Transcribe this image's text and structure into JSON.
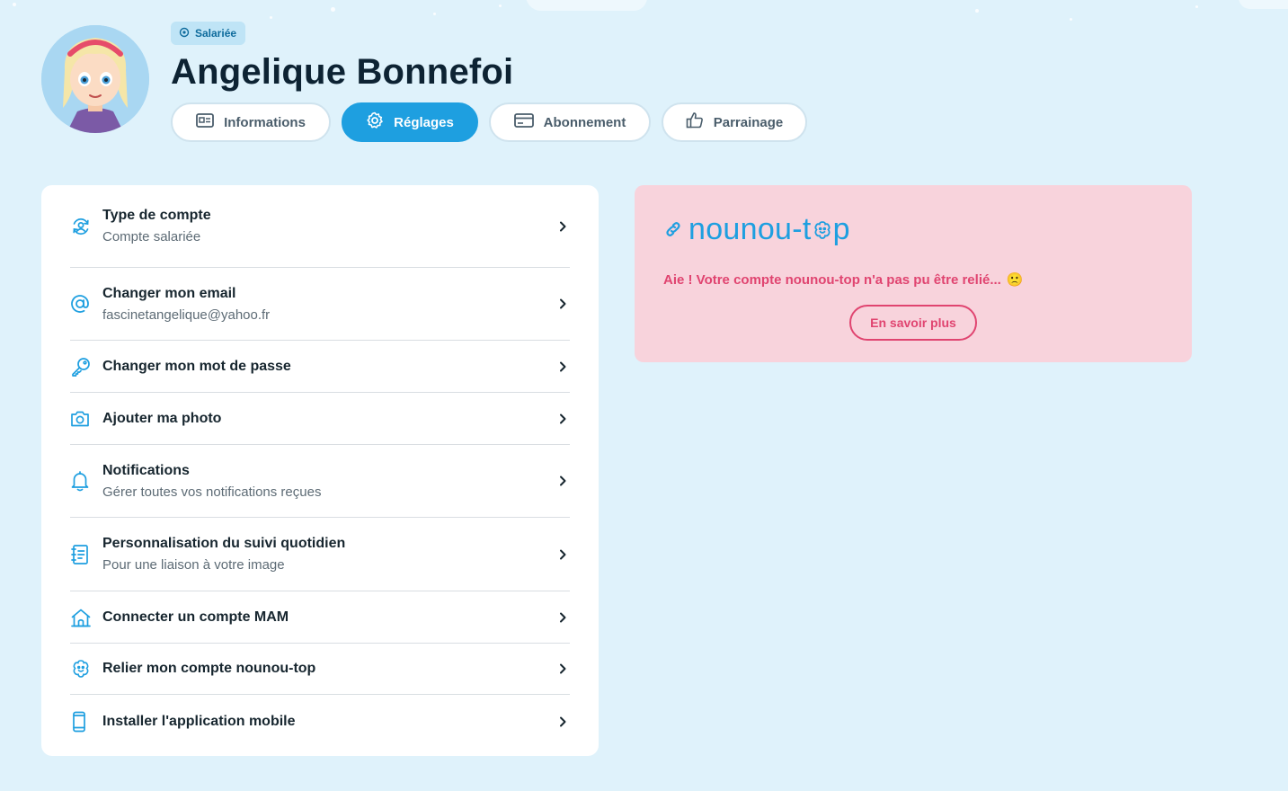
{
  "profile": {
    "badge_label": "Salariée",
    "name": "Angelique Bonnefoi"
  },
  "tabs": [
    {
      "label": "Informations",
      "icon": "id-card-icon",
      "active": false
    },
    {
      "label": "Réglages",
      "icon": "gear-icon",
      "active": true
    },
    {
      "label": "Abonnement",
      "icon": "credit-card-icon",
      "active": false
    },
    {
      "label": "Parrainage",
      "icon": "thumbs-up-icon",
      "active": false
    }
  ],
  "settings": [
    {
      "title": "Type de compte",
      "subtitle": "Compte salariée",
      "icon": "account-switch-icon"
    },
    {
      "title": "Changer mon email",
      "subtitle": "fascinetangelique@yahoo.fr",
      "icon": "at-sign-icon"
    },
    {
      "title": "Changer mon mot de passe",
      "subtitle": "",
      "icon": "key-icon"
    },
    {
      "title": "Ajouter ma photo",
      "subtitle": "",
      "icon": "camera-icon"
    },
    {
      "title": "Notifications",
      "subtitle": "Gérer toutes vos notifications reçues",
      "icon": "bell-icon"
    },
    {
      "title": "Personnalisation du suivi quotidien",
      "subtitle": "Pour une liaison à votre image",
      "icon": "notebook-icon"
    },
    {
      "title": "Connecter un compte MAM",
      "subtitle": "",
      "icon": "house-icon"
    },
    {
      "title": "Relier mon compte nounou-top",
      "subtitle": "",
      "icon": "flower-smile-icon"
    },
    {
      "title": "Installer l'application mobile",
      "subtitle": "",
      "icon": "smartphone-icon"
    }
  ],
  "nounou": {
    "logo_text_1": "nounou-t",
    "logo_text_2": "p",
    "message": "Aie ! Votre compte nounou-top n'a pas pu être relié...",
    "emoji": "🙁",
    "button_label": "En savoir plus"
  },
  "colors": {
    "accent": "#1e9fe0",
    "background": "#dff2fb",
    "alert_bg": "#f8d3dc",
    "alert_text": "#e04470"
  }
}
